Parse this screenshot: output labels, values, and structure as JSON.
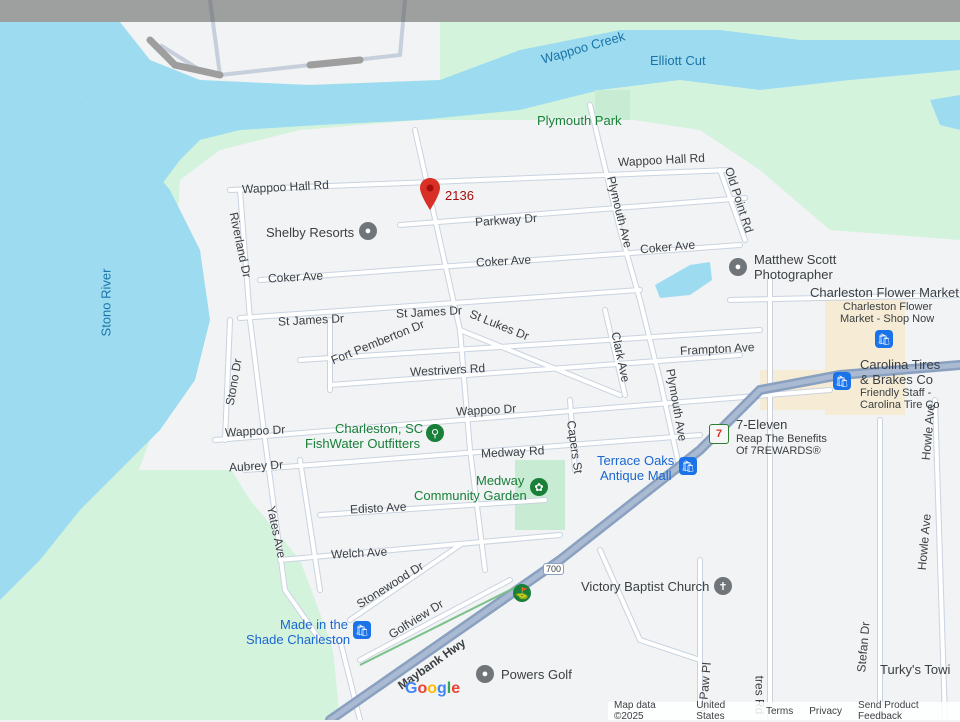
{
  "water": {
    "creek": "Wappoo Creek",
    "cut": "Elliott Cut",
    "river": "Stono River"
  },
  "pin": {
    "label": "2136",
    "color": "#d93025"
  },
  "streets": {
    "wappoo_hall_rd_1": "Wappoo Hall Rd",
    "wappoo_hall_rd_2": "Wappoo Hall Rd",
    "old_point_rd": "Old Point Rd",
    "parkway_dr": "Parkway Dr",
    "plymouth_ave_1": "Plymouth Ave",
    "plymouth_ave_2": "Plymouth Ave",
    "riverland_dr": "Riverland Dr",
    "coker_ave_1": "Coker Ave",
    "coker_ave_2": "Coker Ave",
    "coker_ave_3": "Coker Ave",
    "st_james_dr_1": "St James Dr",
    "st_james_dr_2": "St James Dr",
    "st_lukes_dr": "St Lukes Dr",
    "fort_pemberton_dr": "Fort Pemberton Dr",
    "clark_ave": "Clark Ave",
    "frampton_ave": "Frampton Ave",
    "westrivers_rd": "Westrivers Rd",
    "stono_dr": "Stono Dr",
    "wappoo_dr_1": "Wappoo Dr",
    "wappoo_dr_2": "Wappoo Dr",
    "aubrey_dr": "Aubrey Dr",
    "medway_rd": "Medway Rd",
    "capers_st": "Capers St",
    "edisto_ave": "Edisto Ave",
    "yates_ave": "Yates Ave",
    "welch_ave": "Welch Ave",
    "stonewood_dr": "Stonewood Dr",
    "golfview_dr": "Golfview Dr",
    "maybank_hwy": "Maybank Hwy",
    "route_shield": "700",
    "howle_ave_1": "Howle Ave",
    "howle_ave_2": "Howle Ave",
    "stefan_dr": "Stefan Dr",
    "paw_pl": "w Paw Pl",
    "tres_rd": "tres Rd"
  },
  "pois": {
    "plymouth_park": "Plymouth Park",
    "shelby_resorts": "Shelby Resorts",
    "matthew_scott_1": "Matthew Scott",
    "matthew_scott_2": "Photographer",
    "charleston_flower_market": "Charleston Flower Market",
    "cfm_sub_1": "Charleston Flower",
    "cfm_sub_2": "Market - Shop Now",
    "carolina_tires_1": "Carolina Tires",
    "carolina_tires_2": "& Brakes Co",
    "carolina_sub_1": "Friendly Staff -",
    "carolina_sub_2": "Carolina Tire Co",
    "fishwater_1": "Charleston, SC",
    "fishwater_2": "FishWater Outfitters",
    "seven_eleven": "7-Eleven",
    "seven_sub_1": "Reap The Benefits",
    "seven_sub_2": "Of 7REWARDS®",
    "terrace_oaks_1": "Terrace Oaks",
    "terrace_oaks_2": "Antique Mall",
    "medway_garden_1": "Medway",
    "medway_garden_2": "Community Garden",
    "victory_baptist": "Victory Baptist Church",
    "made_in_shade_1": "Made in the",
    "made_in_shade_2": "Shade Charleston",
    "powers_golf": "Powers Golf",
    "turkys": "Turky's Towi"
  },
  "footer": {
    "logo": "Google",
    "map_data": "Map data ©2025",
    "country": "United States",
    "terms": "Terms",
    "privacy": "Privacy",
    "feedback": "Send Product Feedback"
  },
  "colors": {
    "water": "#9ddcf0",
    "park": "#d4f3dd",
    "land": "#f1f3f4",
    "road": "#ffffff",
    "road_stroke": "#c6d0dc",
    "highway": "#8aa0c0",
    "commercial": "#f6ecd6"
  }
}
